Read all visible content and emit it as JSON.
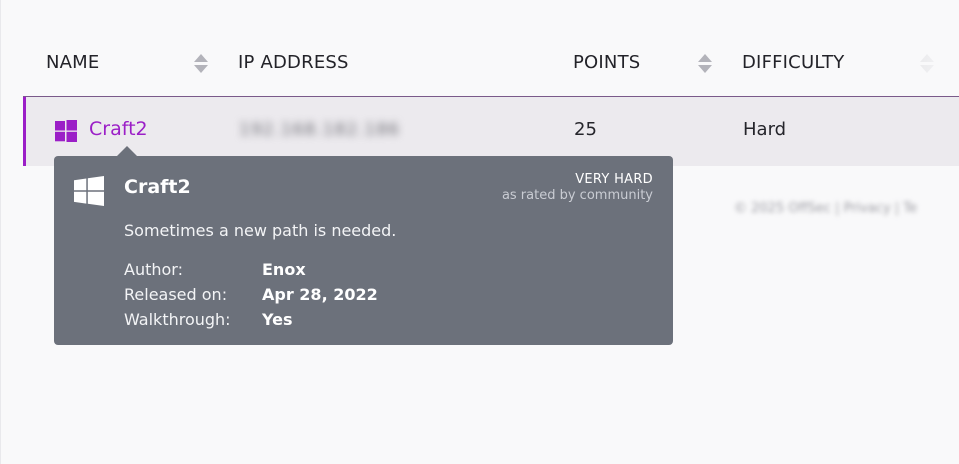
{
  "table": {
    "columns": {
      "name": "NAME",
      "ip": "IP ADDRESS",
      "points": "POINTS",
      "difficulty": "DIFFICULTY"
    },
    "row": {
      "name": "Craft2",
      "ip": "192.168.182.186",
      "points": "25",
      "difficulty": "Hard",
      "os_icon": "windows-icon"
    }
  },
  "tooltip": {
    "title": "Craft2",
    "rating": "VERY HARD",
    "rating_note": "as rated by community",
    "description": "Sometimes a new path is needed.",
    "author_label": "Author:",
    "author": "Enox",
    "released_label": "Released on:",
    "released": "Apr 28, 2022",
    "walkthrough_label": "Walkthrough:",
    "walkthrough": "Yes"
  },
  "footer": {
    "text": "© 2025 OffSec | Privacy | Te"
  },
  "colors": {
    "accent": "#9b1fc7",
    "tooltip_bg": "#6c717b",
    "row_bg": "#eceaee"
  }
}
